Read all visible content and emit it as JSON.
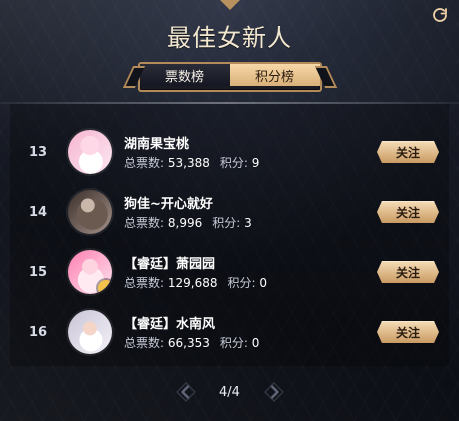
{
  "header": {
    "title": "最佳女新人"
  },
  "tabs": [
    {
      "label": "票数榜",
      "active": true
    },
    {
      "label": "积分榜",
      "active": false
    }
  ],
  "list": {
    "items": [
      {
        "rank": "13",
        "name": "湖南果宝桃",
        "votes_label": "总票数:",
        "votes": "53,388",
        "points_label": "积分:",
        "points": "9",
        "follow_label": "关注"
      },
      {
        "rank": "14",
        "name": "狗佳~开心就好",
        "votes_label": "总票数:",
        "votes": "8,996",
        "points_label": "积分:",
        "points": "3",
        "follow_label": "关注"
      },
      {
        "rank": "15",
        "name": "【睿廷】萧园园",
        "votes_label": "总票数:",
        "votes": "129,688",
        "points_label": "积分:",
        "points": "0",
        "follow_label": "关注"
      },
      {
        "rank": "16",
        "name": "【睿廷】水南风",
        "votes_label": "总票数:",
        "votes": "66,353",
        "points_label": "积分:",
        "points": "0",
        "follow_label": "关注"
      }
    ]
  },
  "pager": {
    "text": "4/4",
    "prev_icon": "chevron-left-icon",
    "next_icon": "chevron-right-icon"
  },
  "icons": {
    "refresh": "refresh-icon"
  },
  "colors": {
    "gold": "#c99a62",
    "gold_light": "#f5ddb7"
  }
}
